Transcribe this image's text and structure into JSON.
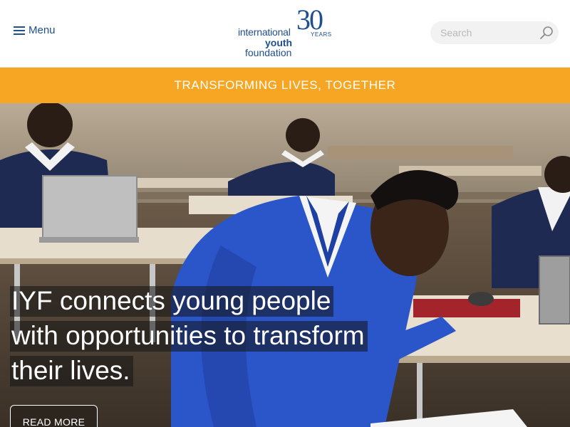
{
  "header": {
    "menu_label": "Menu",
    "logo": {
      "line1": "international",
      "line2": "youth",
      "line3": "foundation",
      "anniversary_number": "30",
      "anniversary_label": "YEARS"
    },
    "search": {
      "placeholder": "Search",
      "value": ""
    }
  },
  "banner": {
    "text": "TRANSFORMING LIVES, TOGETHER"
  },
  "hero": {
    "headline": "IYF connects young people with opportunities to transform their lives.",
    "cta_label": "READ MORE"
  },
  "colors": {
    "brand_blue": "#1d4f91",
    "banner_orange": "#f6a623"
  },
  "icons": {
    "menu": "menu-icon",
    "search": "search-icon"
  }
}
